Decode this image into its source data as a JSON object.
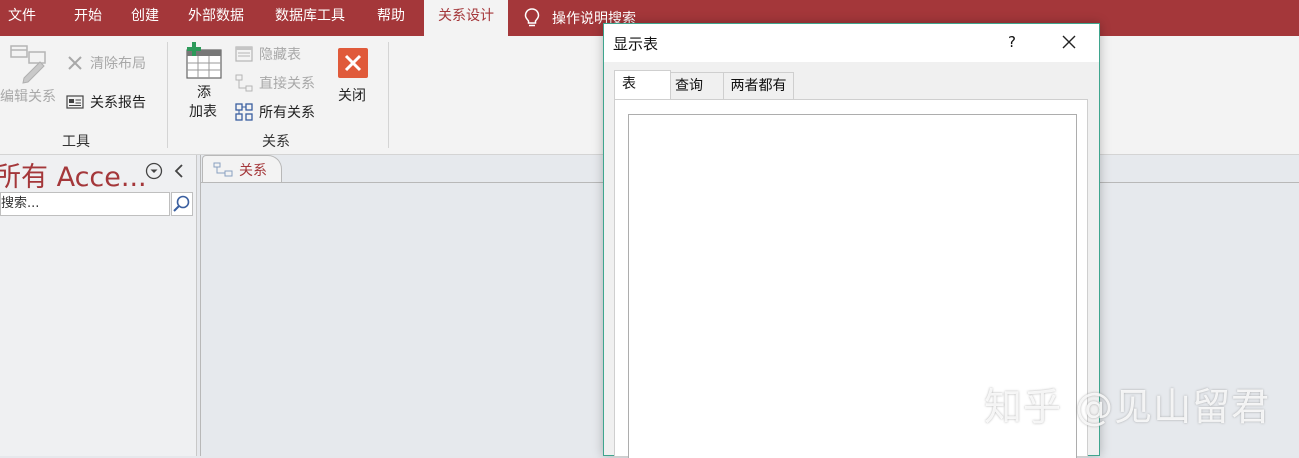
{
  "ribbon_tabs": [
    "文件",
    "开始",
    "创建",
    "外部数据",
    "数据库工具",
    "帮助",
    "关系设计"
  ],
  "tell_me": "操作说明搜索",
  "ribbon": {
    "tools": {
      "edit_relationships": "编辑关系",
      "clear_layout": "清除布局",
      "relationship_report": "关系报告",
      "group_label": "工具"
    },
    "relationships": {
      "add_table_line1": "添",
      "add_table_line2": "加表",
      "hide_table": "隐藏表",
      "direct_relationships": "直接关系",
      "all_relationships": "所有关系",
      "close": "关闭",
      "group_label": "关系"
    }
  },
  "nav": {
    "title": "所有 Acce...",
    "search_placeholder": "搜索..."
  },
  "document_tab": "关系",
  "dialog": {
    "title": "显示表",
    "help": "?",
    "tabs": [
      "表",
      "查询",
      "两者都有"
    ]
  },
  "watermark": "知乎 @见山留君",
  "colors": {
    "accent": "#a4373a",
    "dialog_border": "#3fa58e",
    "close_button": "#e05a3a"
  }
}
